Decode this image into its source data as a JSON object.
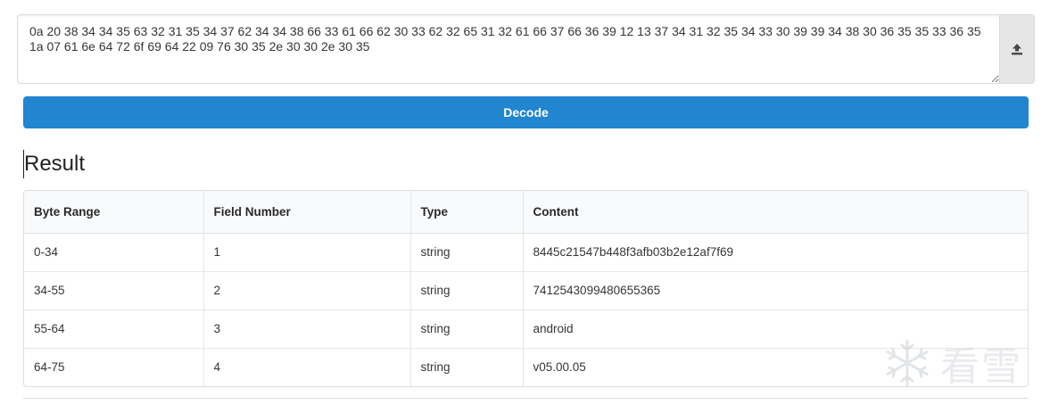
{
  "input": {
    "value": "0a 20 38 34 34 35 63 32 31 35 34 37 62 34 34 38 66 33 61 66 62 30 33 62 32 65 31 32 61 66 37 66 36 39 12 13 37 34 31 32 35 34 33 30 39 39 34 38 30 36 35 35 33 36 35 1a 07 61 6e 64 72 6f 69 64 22 09 76 30 35 2e 30 30 2e 30 35",
    "upload_icon": "upload-icon"
  },
  "decode_button": {
    "label": "Decode",
    "color": "#2185d0"
  },
  "result": {
    "title": "Result",
    "columns": [
      "Byte Range",
      "Field Number",
      "Type",
      "Content"
    ],
    "rows": [
      [
        "0-34",
        "1",
        "string",
        "8445c21547b448f3afb03b2e12af7f69"
      ],
      [
        "34-55",
        "2",
        "string",
        "7412543099480655365"
      ],
      [
        "55-64",
        "3",
        "string",
        "android"
      ],
      [
        "64-75",
        "4",
        "string",
        "v05.00.05"
      ]
    ]
  },
  "watermark": {
    "icon": "snowflake-logo",
    "text": "看雪"
  }
}
